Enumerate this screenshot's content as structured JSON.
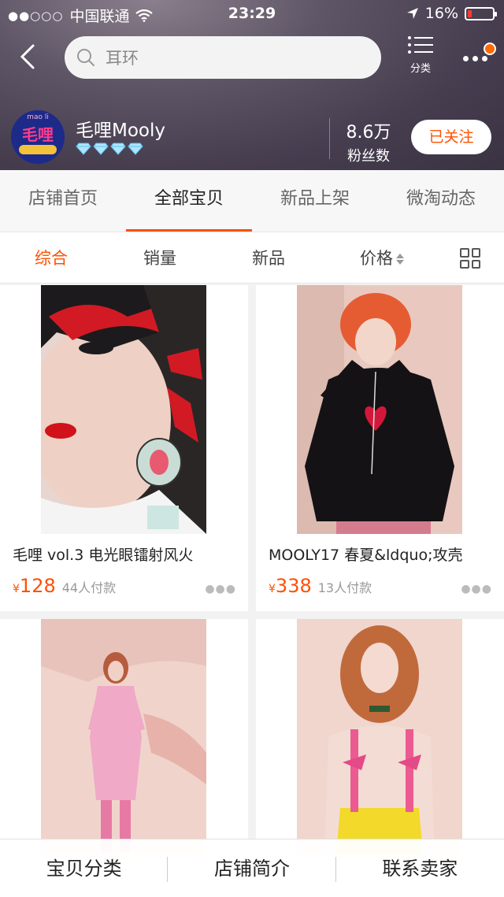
{
  "status_bar": {
    "carrier": "中国联通",
    "time": "23:29",
    "battery": "16%",
    "battery_level": 0.16
  },
  "search": {
    "placeholder": "耳环"
  },
  "nav": {
    "category_label": "分类"
  },
  "shop": {
    "logo_text_top": "mao li",
    "logo_text_main": "毛哩",
    "name": "毛哩Mooly",
    "diamond_count": 4,
    "fans_count": "8.6万",
    "fans_label": "粉丝数",
    "follow_label": "已关注"
  },
  "tabs": [
    {
      "label": "店铺首页"
    },
    {
      "label": "全部宝贝"
    },
    {
      "label": "新品上架"
    },
    {
      "label": "微淘动态"
    }
  ],
  "sort": [
    {
      "label": "综合"
    },
    {
      "label": "销量"
    },
    {
      "label": "新品"
    },
    {
      "label": "价格"
    }
  ],
  "products": [
    {
      "title": "毛哩  vol.3 电光眼镭射风火",
      "currency": "¥",
      "price": "128",
      "sold": "44人付款"
    },
    {
      "title": "MOOLY17 春夏&ldquo;攻壳",
      "currency": "¥",
      "price": "338",
      "sold": "13人付款"
    },
    {
      "title": "",
      "currency": "",
      "price": "",
      "sold": ""
    },
    {
      "title": "",
      "currency": "",
      "price": "",
      "sold": ""
    }
  ],
  "bottom_bar": [
    {
      "label": "宝贝分类"
    },
    {
      "label": "店铺简介"
    },
    {
      "label": "联系卖家"
    }
  ],
  "colors": {
    "accent": "#ff5000",
    "header_bg": "#4a4252"
  }
}
